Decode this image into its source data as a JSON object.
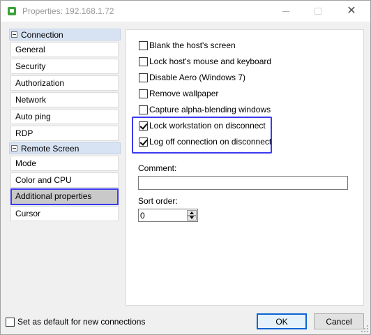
{
  "window": {
    "title": "Properties: 192.168.1.72",
    "close_glyph": "✕"
  },
  "sidebar": {
    "groups": [
      {
        "label": "Connection",
        "items": [
          "General",
          "Security",
          "Authorization",
          "Network",
          "Auto ping",
          "RDP"
        ]
      },
      {
        "label": "Remote Screen",
        "items": [
          "Mode",
          "Color and CPU",
          "Additional properties",
          "Cursor"
        ]
      }
    ],
    "selected_item": "Additional properties"
  },
  "options": {
    "blank_screen": {
      "label": "Blank the host's screen",
      "checked": false
    },
    "lock_input": {
      "label": "Lock host's mouse and keyboard",
      "checked": false
    },
    "disable_aero": {
      "label": "Disable Aero (Windows 7)",
      "checked": false
    },
    "remove_wallpaper": {
      "label": "Remove wallpaper",
      "checked": false
    },
    "alpha_blending": {
      "label": "Capture alpha-blending windows",
      "checked": false
    },
    "lock_workstation": {
      "label": "Lock workstation on disconnect",
      "checked": true
    },
    "log_off": {
      "label": "Log off connection on disconnect",
      "checked": true
    }
  },
  "comment": {
    "label": "Comment:",
    "value": ""
  },
  "sort_order": {
    "label": "Sort order:",
    "value": "0"
  },
  "footer": {
    "default_label": "Set as default for new connections",
    "default_checked": false,
    "ok_label": "OK",
    "cancel_label": "Cancel"
  },
  "colors": {
    "highlight": "#3a3af0",
    "group_header_bg": "#d7e3f3",
    "selected_bg": "#c9c9c9",
    "app_icon": "#3aa23a"
  }
}
